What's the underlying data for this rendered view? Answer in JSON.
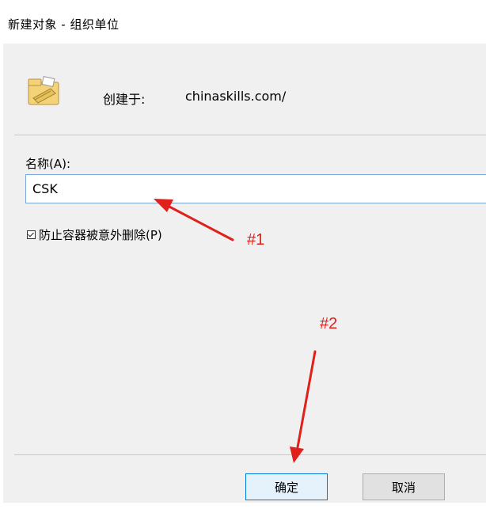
{
  "window": {
    "title": "新建对象 - 组织单位"
  },
  "dialog": {
    "created_in_label": "创建于:",
    "created_in_value": "chinaskills.com/",
    "name_label": "名称(A):",
    "name_value": "CSK",
    "protect_checkbox_label": "防止容器被意外删除(P)",
    "protect_checkbox_checked": true,
    "ok_button": "确定",
    "cancel_button": "取消"
  },
  "annotations": {
    "marker_1": "#1",
    "marker_2": "#2",
    "color": "#e0201a"
  },
  "icons": {
    "ou_icon": "organizational-unit-folder-icon"
  }
}
